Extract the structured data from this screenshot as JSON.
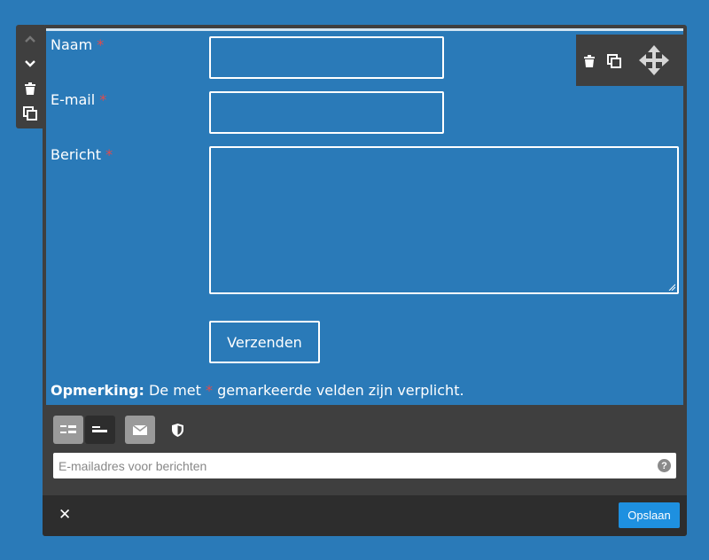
{
  "form": {
    "fields": [
      {
        "label": "Naam",
        "required_mark": "*"
      },
      {
        "label": "E-mail",
        "required_mark": "*"
      },
      {
        "label": "Bericht",
        "required_mark": "*"
      }
    ],
    "submit_label": "Verzenden",
    "note": {
      "bold": "Opmerking:",
      "before": "De met",
      "mark": "*",
      "after": "gemarkeerde velden zijn verplicht."
    }
  },
  "settings": {
    "email_placeholder": "E-mailadres voor berichten",
    "help": "?"
  },
  "footer": {
    "close": "✕",
    "save_label": "Opslaan"
  },
  "icons": {
    "side_toolbar": [
      "chevron-up-icon",
      "chevron-down-icon",
      "trash-icon",
      "duplicate-icon"
    ],
    "row_toolbar": [
      "trash-icon",
      "duplicate-icon",
      "move-icon"
    ],
    "settings_toolbar": [
      "layout-labels-left-icon",
      "layout-labels-top-icon",
      "mail-icon",
      "shield-icon"
    ]
  },
  "colors": {
    "background": "#2a7ab8",
    "panel": "#3f3f3f",
    "footer": "#2d2d2d",
    "required": "#e24b4b",
    "save_button": "#1e90e0"
  }
}
